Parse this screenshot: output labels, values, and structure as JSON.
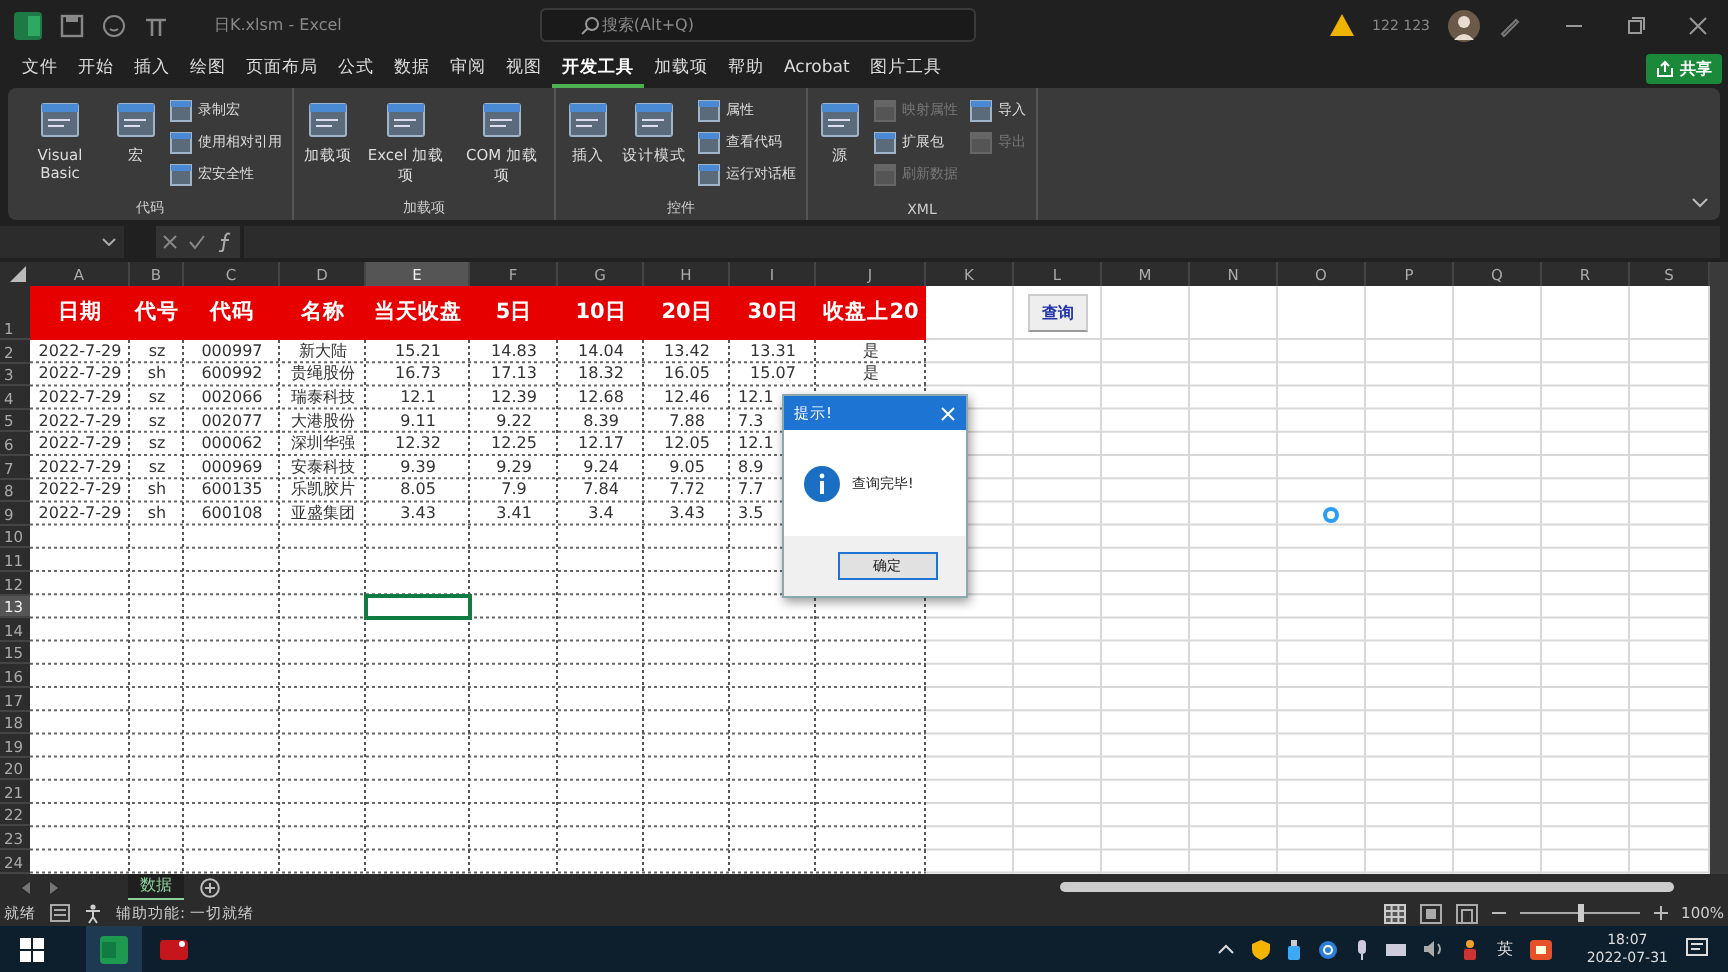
{
  "window": {
    "title": "日K.xlsm - Excel",
    "search_placeholder": "搜索(Alt+Q)",
    "user": "122 123"
  },
  "menu_tabs": [
    {
      "label": "文件",
      "selected": false
    },
    {
      "label": "开始",
      "selected": false
    },
    {
      "label": "插入",
      "selected": false
    },
    {
      "label": "绘图",
      "selected": false
    },
    {
      "label": "页面布局",
      "selected": false
    },
    {
      "label": "公式",
      "selected": false
    },
    {
      "label": "数据",
      "selected": false
    },
    {
      "label": "审阅",
      "selected": false
    },
    {
      "label": "视图",
      "selected": false
    },
    {
      "label": "开发工具",
      "selected": true
    },
    {
      "label": "加载项",
      "selected": false
    },
    {
      "label": "帮助",
      "selected": false
    },
    {
      "label": "Acrobat",
      "selected": false
    },
    {
      "label": "图片工具",
      "selected": false
    }
  ],
  "share_button": "共享",
  "ribbon_groups": [
    {
      "label": "代码",
      "items": [
        {
          "label": "Visual Basic",
          "kind": "large",
          "disabled": false
        },
        {
          "label": "宏",
          "kind": "large",
          "disabled": false
        },
        {
          "label": "录制宏",
          "kind": "small",
          "disabled": false
        },
        {
          "label": "使用相对引用",
          "kind": "small",
          "disabled": false
        },
        {
          "label": "宏安全性",
          "kind": "small",
          "disabled": false
        }
      ]
    },
    {
      "label": "加载项",
      "items": [
        {
          "label": "加载项",
          "kind": "large",
          "disabled": false
        },
        {
          "label": "Excel 加载项",
          "kind": "large",
          "disabled": false
        },
        {
          "label": "COM 加载项",
          "kind": "large",
          "disabled": false
        }
      ]
    },
    {
      "label": "控件",
      "items": [
        {
          "label": "插入",
          "kind": "large",
          "disabled": false
        },
        {
          "label": "设计模式",
          "kind": "large",
          "disabled": false
        },
        {
          "label": "属性",
          "kind": "small",
          "disabled": false
        },
        {
          "label": "查看代码",
          "kind": "small",
          "disabled": false
        },
        {
          "label": "运行对话框",
          "kind": "small",
          "disabled": false
        }
      ]
    },
    {
      "label": "XML",
      "items": [
        {
          "label": "源",
          "kind": "large",
          "disabled": false
        },
        {
          "label": "映射属性",
          "kind": "small",
          "disabled": true
        },
        {
          "label": "扩展包",
          "kind": "small",
          "disabled": false
        },
        {
          "label": "刷新数据",
          "kind": "small",
          "disabled": true
        },
        {
          "label": "导入",
          "kind": "small",
          "disabled": false
        },
        {
          "label": "导出",
          "kind": "small",
          "disabled": true
        }
      ]
    }
  ],
  "sheet": {
    "columns": [
      {
        "label": "A",
        "selected": false
      },
      {
        "label": "B",
        "selected": false
      },
      {
        "label": "C",
        "selected": false
      },
      {
        "label": "D",
        "selected": false
      },
      {
        "label": "E",
        "selected": true
      },
      {
        "label": "F",
        "selected": false
      },
      {
        "label": "G",
        "selected": false
      },
      {
        "label": "H",
        "selected": false
      },
      {
        "label": "I",
        "selected": false
      },
      {
        "label": "J",
        "selected": false
      },
      {
        "label": "K",
        "selected": false
      },
      {
        "label": "L",
        "selected": false
      },
      {
        "label": "M",
        "selected": false
      },
      {
        "label": "N",
        "selected": false
      },
      {
        "label": "O",
        "selected": false
      },
      {
        "label": "P",
        "selected": false
      },
      {
        "label": "Q",
        "selected": false
      },
      {
        "label": "R",
        "selected": false
      },
      {
        "label": "S",
        "selected": false
      }
    ],
    "row_headers": [
      {
        "label": "1",
        "selected": false
      },
      {
        "label": "2",
        "selected": false
      },
      {
        "label": "3",
        "selected": false
      },
      {
        "label": "4",
        "selected": false
      },
      {
        "label": "5",
        "selected": false
      },
      {
        "label": "6",
        "selected": false
      },
      {
        "label": "7",
        "selected": false
      },
      {
        "label": "8",
        "selected": false
      },
      {
        "label": "9",
        "selected": false
      },
      {
        "label": "10",
        "selected": false
      },
      {
        "label": "11",
        "selected": false
      },
      {
        "label": "12",
        "selected": false
      },
      {
        "label": "13",
        "selected": true
      },
      {
        "label": "14",
        "selected": false
      },
      {
        "label": "15",
        "selected": false
      },
      {
        "label": "16",
        "selected": false
      },
      {
        "label": "17",
        "selected": false
      },
      {
        "label": "18",
        "selected": false
      },
      {
        "label": "19",
        "selected": false
      },
      {
        "label": "20",
        "selected": false
      },
      {
        "label": "21",
        "selected": false
      },
      {
        "label": "22",
        "selected": false
      },
      {
        "label": "23",
        "selected": false
      },
      {
        "label": "24",
        "selected": false
      }
    ],
    "header_row": [
      "日期",
      "代号",
      "代码",
      "名称",
      "当天收盘",
      "5日",
      "10日",
      "20日",
      "30日",
      "收盘上20"
    ],
    "rows": [
      [
        "2022-7-29",
        "sz",
        "000997",
        "新大陆",
        "15.21",
        "14.83",
        "14.04",
        "13.42",
        "13.31",
        "是"
      ],
      [
        "2022-7-29",
        "sh",
        "600992",
        "贵绳股份",
        "16.73",
        "17.13",
        "18.32",
        "16.05",
        "15.07",
        "是"
      ],
      [
        "2022-7-29",
        "sz",
        "002066",
        "瑞泰科技",
        "12.1",
        "12.39",
        "12.68",
        "12.46",
        "12.1"
      ],
      [
        "2022-7-29",
        "sz",
        "002077",
        "大港股份",
        "9.11",
        "9.22",
        "8.39",
        "7.88",
        "7.3"
      ],
      [
        "2022-7-29",
        "sz",
        "000062",
        "深圳华强",
        "12.32",
        "12.25",
        "12.17",
        "12.05",
        "12.1"
      ],
      [
        "2022-7-29",
        "sz",
        "000969",
        "安泰科技",
        "9.39",
        "9.29",
        "9.24",
        "9.05",
        "8.9"
      ],
      [
        "2022-7-29",
        "sh",
        "600135",
        "乐凯胶片",
        "8.05",
        "7.9",
        "7.84",
        "7.72",
        "7.7"
      ],
      [
        "2022-7-29",
        "sh",
        "600108",
        "亚盛集团",
        "3.43",
        "3.41",
        "3.4",
        "3.43",
        "3.5"
      ]
    ],
    "query_button": "查询"
  },
  "dialog": {
    "title": "提示!",
    "message": "查询完毕!",
    "button": "确定"
  },
  "sheet_tabs": [
    {
      "label": "数据",
      "selected": true
    }
  ],
  "status_bar": {
    "ready": "就绪",
    "accessibility": "辅助功能: 一切就绪",
    "zoom": "100%",
    "zoom_slider": {
      "level": 0.5
    }
  },
  "taskbar": {
    "ime": "英",
    "time": "18:07",
    "date": "2022-07-31"
  }
}
